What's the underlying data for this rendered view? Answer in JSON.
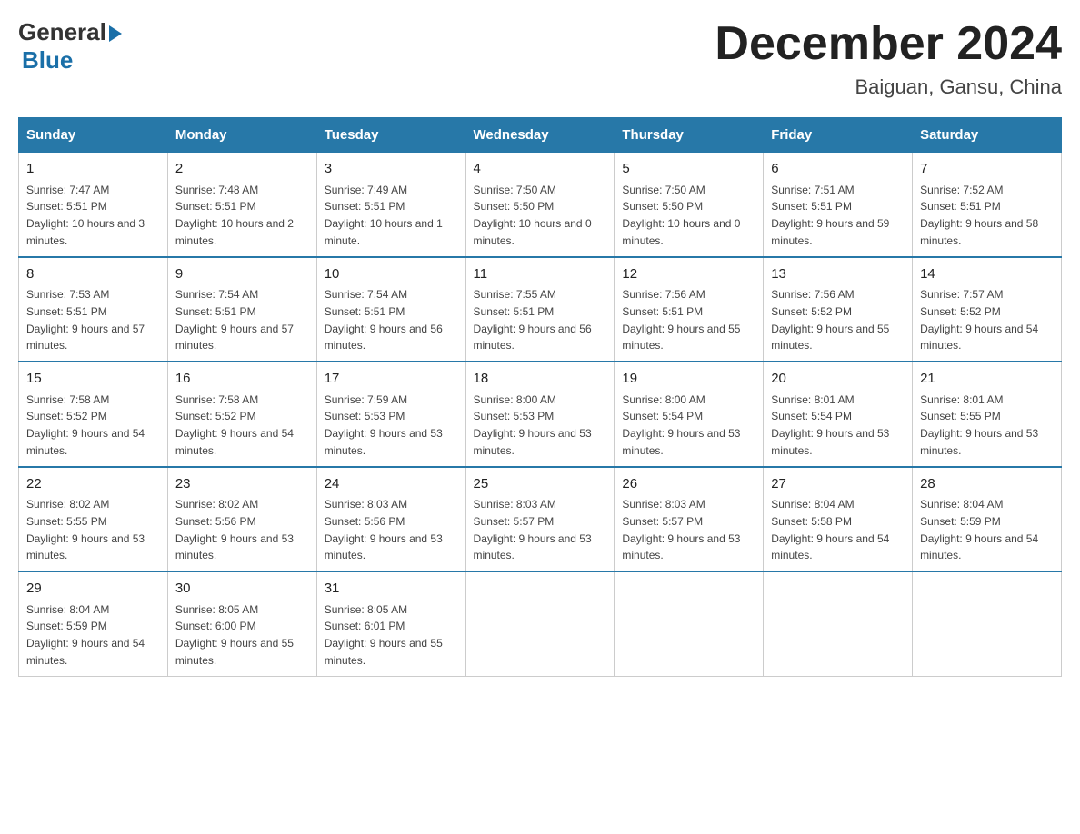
{
  "logo": {
    "text_general": "General",
    "text_blue": "Blue"
  },
  "title": {
    "month_year": "December 2024",
    "location": "Baiguan, Gansu, China"
  },
  "header_row": {
    "days": [
      "Sunday",
      "Monday",
      "Tuesday",
      "Wednesday",
      "Thursday",
      "Friday",
      "Saturday"
    ]
  },
  "weeks": [
    {
      "days": [
        {
          "num": "1",
          "sunrise": "7:47 AM",
          "sunset": "5:51 PM",
          "daylight": "10 hours and 3 minutes."
        },
        {
          "num": "2",
          "sunrise": "7:48 AM",
          "sunset": "5:51 PM",
          "daylight": "10 hours and 2 minutes."
        },
        {
          "num": "3",
          "sunrise": "7:49 AM",
          "sunset": "5:51 PM",
          "daylight": "10 hours and 1 minute."
        },
        {
          "num": "4",
          "sunrise": "7:50 AM",
          "sunset": "5:50 PM",
          "daylight": "10 hours and 0 minutes."
        },
        {
          "num": "5",
          "sunrise": "7:50 AM",
          "sunset": "5:50 PM",
          "daylight": "10 hours and 0 minutes."
        },
        {
          "num": "6",
          "sunrise": "7:51 AM",
          "sunset": "5:51 PM",
          "daylight": "9 hours and 59 minutes."
        },
        {
          "num": "7",
          "sunrise": "7:52 AM",
          "sunset": "5:51 PM",
          "daylight": "9 hours and 58 minutes."
        }
      ]
    },
    {
      "days": [
        {
          "num": "8",
          "sunrise": "7:53 AM",
          "sunset": "5:51 PM",
          "daylight": "9 hours and 57 minutes."
        },
        {
          "num": "9",
          "sunrise": "7:54 AM",
          "sunset": "5:51 PM",
          "daylight": "9 hours and 57 minutes."
        },
        {
          "num": "10",
          "sunrise": "7:54 AM",
          "sunset": "5:51 PM",
          "daylight": "9 hours and 56 minutes."
        },
        {
          "num": "11",
          "sunrise": "7:55 AM",
          "sunset": "5:51 PM",
          "daylight": "9 hours and 56 minutes."
        },
        {
          "num": "12",
          "sunrise": "7:56 AM",
          "sunset": "5:51 PM",
          "daylight": "9 hours and 55 minutes."
        },
        {
          "num": "13",
          "sunrise": "7:56 AM",
          "sunset": "5:52 PM",
          "daylight": "9 hours and 55 minutes."
        },
        {
          "num": "14",
          "sunrise": "7:57 AM",
          "sunset": "5:52 PM",
          "daylight": "9 hours and 54 minutes."
        }
      ]
    },
    {
      "days": [
        {
          "num": "15",
          "sunrise": "7:58 AM",
          "sunset": "5:52 PM",
          "daylight": "9 hours and 54 minutes."
        },
        {
          "num": "16",
          "sunrise": "7:58 AM",
          "sunset": "5:52 PM",
          "daylight": "9 hours and 54 minutes."
        },
        {
          "num": "17",
          "sunrise": "7:59 AM",
          "sunset": "5:53 PM",
          "daylight": "9 hours and 53 minutes."
        },
        {
          "num": "18",
          "sunrise": "8:00 AM",
          "sunset": "5:53 PM",
          "daylight": "9 hours and 53 minutes."
        },
        {
          "num": "19",
          "sunrise": "8:00 AM",
          "sunset": "5:54 PM",
          "daylight": "9 hours and 53 minutes."
        },
        {
          "num": "20",
          "sunrise": "8:01 AM",
          "sunset": "5:54 PM",
          "daylight": "9 hours and 53 minutes."
        },
        {
          "num": "21",
          "sunrise": "8:01 AM",
          "sunset": "5:55 PM",
          "daylight": "9 hours and 53 minutes."
        }
      ]
    },
    {
      "days": [
        {
          "num": "22",
          "sunrise": "8:02 AM",
          "sunset": "5:55 PM",
          "daylight": "9 hours and 53 minutes."
        },
        {
          "num": "23",
          "sunrise": "8:02 AM",
          "sunset": "5:56 PM",
          "daylight": "9 hours and 53 minutes."
        },
        {
          "num": "24",
          "sunrise": "8:03 AM",
          "sunset": "5:56 PM",
          "daylight": "9 hours and 53 minutes."
        },
        {
          "num": "25",
          "sunrise": "8:03 AM",
          "sunset": "5:57 PM",
          "daylight": "9 hours and 53 minutes."
        },
        {
          "num": "26",
          "sunrise": "8:03 AM",
          "sunset": "5:57 PM",
          "daylight": "9 hours and 53 minutes."
        },
        {
          "num": "27",
          "sunrise": "8:04 AM",
          "sunset": "5:58 PM",
          "daylight": "9 hours and 54 minutes."
        },
        {
          "num": "28",
          "sunrise": "8:04 AM",
          "sunset": "5:59 PM",
          "daylight": "9 hours and 54 minutes."
        }
      ]
    },
    {
      "days": [
        {
          "num": "29",
          "sunrise": "8:04 AM",
          "sunset": "5:59 PM",
          "daylight": "9 hours and 54 minutes."
        },
        {
          "num": "30",
          "sunrise": "8:05 AM",
          "sunset": "6:00 PM",
          "daylight": "9 hours and 55 minutes."
        },
        {
          "num": "31",
          "sunrise": "8:05 AM",
          "sunset": "6:01 PM",
          "daylight": "9 hours and 55 minutes."
        },
        null,
        null,
        null,
        null
      ]
    }
  ]
}
